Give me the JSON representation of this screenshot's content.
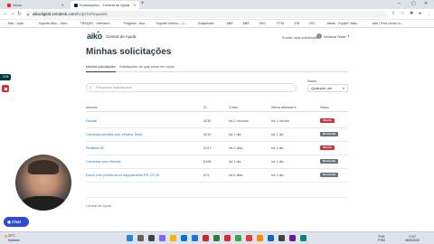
{
  "browser": {
    "tabs": [
      {
        "title": "Inbox",
        "active": false,
        "color": "#d93025"
      },
      {
        "title": "Solicitações – Central de Ajuda",
        "active": true,
        "color": "#03363d"
      }
    ],
    "url_host": "aikodigital.zendesk.com",
    "url_path": "/hc/pt-br/requests",
    "bookmarks": [
      {
        "label": "Aiko - Aplic",
        "color": "#0f9d58"
      },
      {
        "label": "Suporte Aiko – Sem...",
        "color": "#f4b400"
      },
      {
        "label": "TRAQSY - relevanci...",
        "color": "#4285f4"
      },
      {
        "label": "Progenio - Ass...",
        "color": "#db4437"
      },
      {
        "label": "Suporte Interno – C...",
        "color": "#03363d"
      },
      {
        "label": "Snapshoter",
        "color": "#34a853"
      },
      {
        "label": "ABE",
        "color": "#5f6368"
      },
      {
        "label": "ABR",
        "color": "#5f6368"
      },
      {
        "label": "VEG",
        "color": "#5f6368"
      },
      {
        "label": "FTM",
        "color": "#5f6368"
      },
      {
        "label": "IFB",
        "color": "#5f6368"
      },
      {
        "label": "VST",
        "color": "#5f6368"
      },
      {
        "label": "Ideias - Equipe Vasd...",
        "color": "#4285f4"
      },
      {
        "label": "vale | Free vector ic...",
        "color": "#34a853"
      }
    ]
  },
  "header": {
    "logo": "aiko",
    "help_center": "Central de Ajuda",
    "submit_request": "Enviar uma solicitação",
    "user_name": "Vinicius Teste"
  },
  "main": {
    "title": "Minhas solicitações",
    "tabs": [
      "Minhas solicitações",
      "Solicitações na qual estou em cópia"
    ],
    "search_placeholder": "Pesquisar solicitações",
    "status_label": "Status:",
    "status_value": "Qualquer um",
    "columns": {
      "subject": "Assunto",
      "id": "ID",
      "created": "Criado",
      "activity": "Última atividade ▾",
      "status": "Status"
    },
    "rows": [
      {
        "subject": "Dúvida",
        "id": "#230",
        "created": "há 2 minutos",
        "activity": "há 1 minuto",
        "status": "Aberta",
        "status_color": "#cc3340"
      },
      {
        "subject": "Conversa perdida com Vinicius Teste",
        "id": "#219",
        "created": "há 1 dia",
        "activity": "há 1 dia",
        "status": "Resolvida",
        "status_color": "#68737d"
      },
      {
        "subject": "Relatório BI",
        "id": "#147",
        "created": "há 2 dias",
        "activity": "há 1 dia",
        "status": "Aberta",
        "status_color": "#cc3340"
      },
      {
        "subject": "Conversa com Vinicius",
        "id": "#198",
        "created": "há 1 dia",
        "activity": "há 1 dia",
        "status": "Resolvida",
        "status_color": "#68737d"
      },
      {
        "subject": "Estou com problema no equipamento EP-CP-25",
        "id": "#73",
        "created": "há 6 dias",
        "activity": "há 1 dia",
        "status": "Resolvida",
        "status_color": "#68737d"
      }
    ],
    "footer_link": "Central de Ajuda"
  },
  "overlay": {
    "timer": "0:08",
    "chat_label": "Chat"
  },
  "taskbar": {
    "temperature": "32°C",
    "weather": "Nublado",
    "lang_1": "POR",
    "lang_2": "PTB2",
    "time": "17:07",
    "date": "05/08/2022"
  }
}
